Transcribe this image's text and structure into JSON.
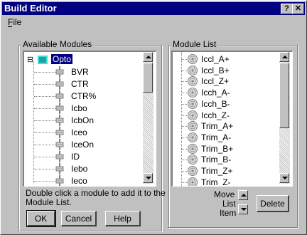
{
  "window": {
    "title": "Build Editor",
    "help_glyph": "?",
    "close_glyph": "✕"
  },
  "menu": {
    "file_label": "File"
  },
  "available": {
    "label": "Available Modules",
    "root_expander": "⊟",
    "root_label": "Opto",
    "items": [
      "BVR",
      "CTR",
      "CTR%",
      "Icbo",
      "IcbOn",
      "Iceo",
      "IceOn",
      "ID",
      "Iebo",
      "Ieco"
    ]
  },
  "hint_line1": "Double click a module to add it to the",
  "hint_line2": "Module List.",
  "buttons": {
    "ok": "OK",
    "cancel": "Cancel",
    "help": "Help"
  },
  "module_list": {
    "label": "Module List",
    "items": [
      "Iccl_A+",
      "Iccl_B+",
      "Iccl_Z+",
      "Icch_A-",
      "Icch_B-",
      "Icch_Z-",
      "Trim_A+",
      "Trim_A-",
      "Trim_B+",
      "Trim_B-",
      "Trim_Z+",
      "Trim_Z-"
    ]
  },
  "move": {
    "line1": "Move",
    "line2": "List",
    "line3": "Item"
  },
  "delete_label": "Delete",
  "colors": {
    "title_bar": "#000080",
    "face": "#c0c0c0",
    "selection": "#000080"
  },
  "icons": {
    "tree_node": "module-chip-icon",
    "list_node": "module-disc-icon"
  }
}
